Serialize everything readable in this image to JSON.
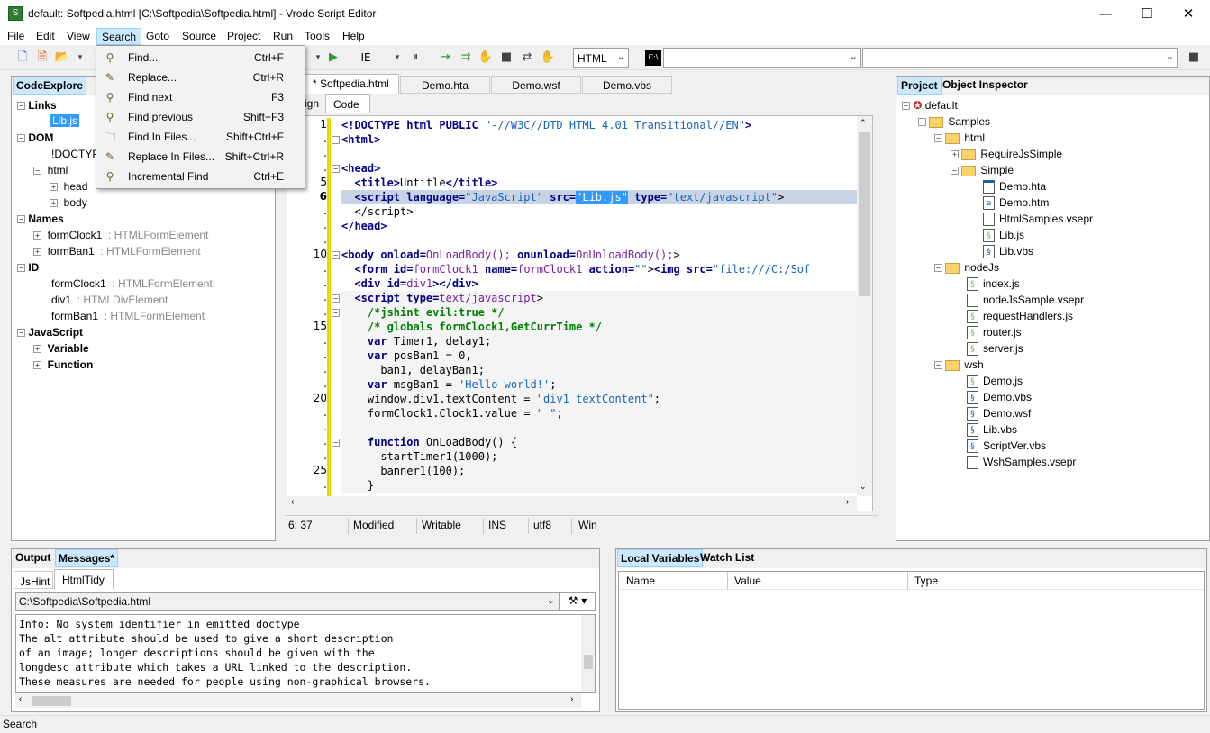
{
  "window": {
    "title": "default: Softpedia.html [C:\\Softpedia\\Softpedia.html] - Vrode Script Editor",
    "minimize": "—",
    "maximize": "☐",
    "close": "✕"
  },
  "menu": [
    "File",
    "Edit",
    "View",
    "Search",
    "Goto",
    "Source",
    "Project",
    "Run",
    "Tools",
    "Help"
  ],
  "toolbar": {
    "browser": "IE",
    "language": "HTML",
    "console_icon": "C:\\"
  },
  "search_menu": [
    {
      "label": "Find...",
      "shortcut": "Ctrl+F",
      "icon": "binoculars-icon"
    },
    {
      "label": "Replace...",
      "shortcut": "Ctrl+R",
      "icon": "replace-icon"
    },
    {
      "label": "Find next",
      "shortcut": "F3",
      "icon": "find-next-icon"
    },
    {
      "label": "Find previous",
      "shortcut": "Shift+F3",
      "icon": "find-previous-icon"
    },
    {
      "label": "Find In Files...",
      "shortcut": "Shift+Ctrl+F",
      "icon": "find-in-files-icon"
    },
    {
      "label": "Replace In Files...",
      "shortcut": "Shift+Ctrl+R",
      "icon": "replace-in-files-icon"
    },
    {
      "label": "Incremental Find",
      "shortcut": "Ctrl+E",
      "icon": "incremental-find-icon"
    }
  ],
  "code_explore": {
    "tab": "CodeExplore",
    "items": {
      "links": "Links",
      "libjs": "Lib.js",
      "dom": "DOM",
      "doctype": "!DOCTYPE",
      "html": "html",
      "head": "head",
      "body": "body",
      "names": "Names",
      "formclock1": "formClock1",
      "formban1": "formBan1",
      "htmlform": ": HTMLFormElement",
      "id": "ID",
      "div1": "div1",
      "htmldiv": ": HTMLDivElement",
      "javascript": "JavaScript",
      "variable": "Variable",
      "function": "Function"
    }
  },
  "editor": {
    "tabs": [
      "* Softpedia.html",
      "Demo.hta",
      "Demo.wsf",
      "Demo.vbs"
    ],
    "subtabs": [
      "ign",
      "Code"
    ],
    "line_numbers": {
      "l1": "1",
      "l5": "5",
      "l6": "6",
      "l10": "10",
      "l15": "15",
      "l20": "20",
      "l25": "25"
    }
  },
  "status": {
    "pos": "6: 37",
    "modified": "Modified",
    "writable": "Writable",
    "ins": "INS",
    "enc": "utf8",
    "eol": "Win"
  },
  "project": {
    "tabs": [
      "Project",
      "Object Inspector"
    ],
    "items": [
      "default",
      "Samples",
      "html",
      "RequireJsSimple",
      "Simple",
      "Demo.hta",
      "Demo.htm",
      "HtmlSamples.vsepr",
      "Lib.js",
      "Lib.vbs",
      "nodeJs",
      "index.js",
      "nodeJsSample.vsepr",
      "requestHandlers.js",
      "router.js",
      "server.js",
      "wsh",
      "Demo.js",
      "Demo.vbs",
      "Demo.wsf",
      "Lib.vbs",
      "ScriptVer.vbs",
      "WshSamples.vsepr"
    ]
  },
  "output": {
    "tabs": [
      "Output",
      "Messages*"
    ],
    "subtabs": [
      "JsHint",
      "HtmlTidy"
    ],
    "file": "C:\\Softpedia\\Softpedia.html",
    "lines": [
      "Info: No system identifier in emitted doctype",
      "The alt attribute should be used to give a short description",
      "of an image; longer descriptions should be given with the",
      "longdesc attribute which takes a URL linked to the description.",
      "These measures are needed for people using non-graphical browsers."
    ]
  },
  "variables": {
    "tabs": [
      "Local Variables",
      "Watch List"
    ],
    "columns": [
      "Name",
      "Value",
      "Type"
    ]
  },
  "statusbar": "Search"
}
